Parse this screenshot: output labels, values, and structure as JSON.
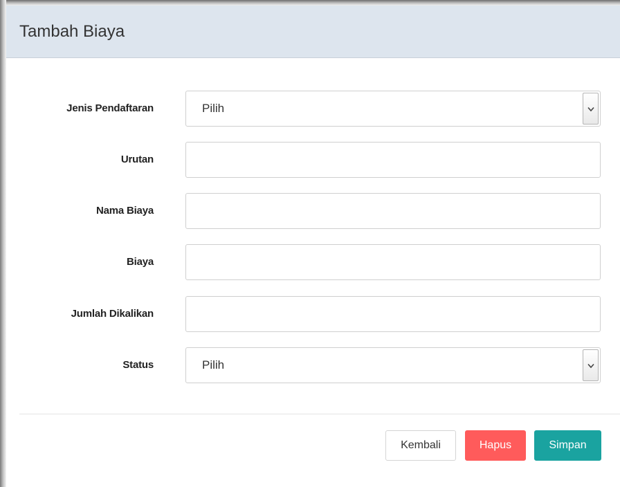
{
  "dialog": {
    "title": "Tambah Biaya"
  },
  "form": {
    "jenis_pendaftaran": {
      "label": "Jenis Pendaftaran",
      "value": "Pilih"
    },
    "urutan": {
      "label": "Urutan",
      "value": ""
    },
    "nama_biaya": {
      "label": "Nama Biaya",
      "value": ""
    },
    "biaya": {
      "label": "Biaya",
      "value": ""
    },
    "jumlah_dikalikan": {
      "label": "Jumlah Dikalikan",
      "value": ""
    },
    "status": {
      "label": "Status",
      "value": "Pilih"
    }
  },
  "footer": {
    "kembali_label": "Kembali",
    "hapus_label": "Hapus",
    "simpan_label": "Simpan"
  },
  "colors": {
    "header_bg": "#dde5ee",
    "danger": "#ff5b5b",
    "primary": "#1aa3a0"
  },
  "icons": {
    "select_arrow": "chevron-down-icon"
  }
}
